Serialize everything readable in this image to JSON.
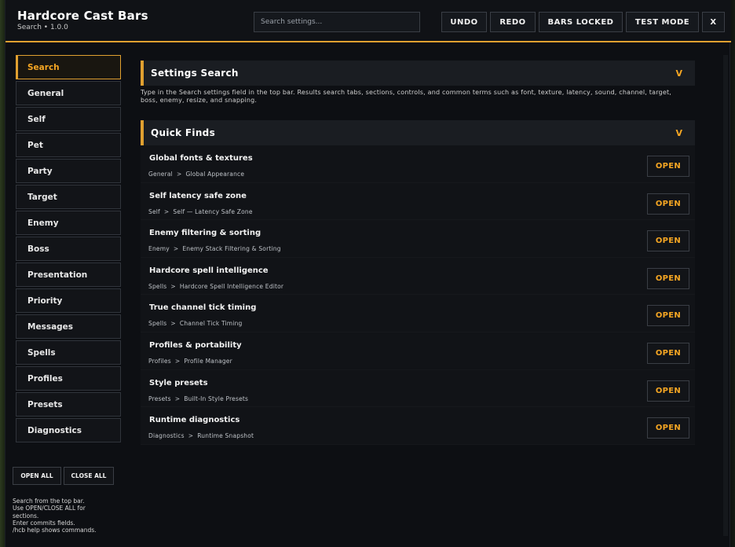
{
  "header": {
    "title": "Hardcore Cast Bars",
    "subtitle": "Search  •  1.0.0",
    "search_placeholder": "Search settings...",
    "buttons": {
      "undo": "UNDO",
      "redo": "REDO",
      "bars_locked": "BARS LOCKED",
      "test_mode": "TEST MODE",
      "close": "X"
    }
  },
  "sidebar": {
    "items": [
      {
        "label": "Search",
        "active": true
      },
      {
        "label": "General"
      },
      {
        "label": "Self"
      },
      {
        "label": "Pet"
      },
      {
        "label": "Party"
      },
      {
        "label": "Target"
      },
      {
        "label": "Enemy"
      },
      {
        "label": "Boss"
      },
      {
        "label": "Presentation"
      },
      {
        "label": "Priority"
      },
      {
        "label": "Messages"
      },
      {
        "label": "Spells"
      },
      {
        "label": "Profiles"
      },
      {
        "label": "Presets"
      },
      {
        "label": "Diagnostics"
      }
    ],
    "open_all": "OPEN ALL",
    "close_all": "CLOSE ALL",
    "help_lines": [
      "Search from the top bar.",
      "Use OPEN/CLOSE ALL for",
      "sections.",
      "Enter commits fields.",
      "/hcb help shows commands."
    ]
  },
  "main": {
    "settings_search": {
      "title": "Settings Search",
      "chevron": "V",
      "description": "Type in the Search settings field in the top bar. Results search tabs, sections, controls, and common terms such as font, texture, latency, sound, channel, target, boss, enemy, resize, and snapping."
    },
    "quick_finds": {
      "title": "Quick Finds",
      "chevron": "V",
      "open_label": "OPEN",
      "path_separator": ">",
      "rows": [
        {
          "title": "Global fonts & textures",
          "tab": "General",
          "section": "Global Appearance"
        },
        {
          "title": "Self latency safe zone",
          "tab": "Self",
          "section": "Self — Latency Safe Zone"
        },
        {
          "title": "Enemy filtering & sorting",
          "tab": "Enemy",
          "section": "Enemy Stack Filtering & Sorting"
        },
        {
          "title": "Hardcore spell intelligence",
          "tab": "Spells",
          "section": "Hardcore Spell Intelligence Editor"
        },
        {
          "title": "True channel tick timing",
          "tab": "Spells",
          "section": "Channel Tick Timing"
        },
        {
          "title": "Profiles & portability",
          "tab": "Profiles",
          "section": "Profile Manager"
        },
        {
          "title": "Style presets",
          "tab": "Presets",
          "section": "Built-In Style Presets"
        },
        {
          "title": "Runtime diagnostics",
          "tab": "Diagnostics",
          "section": "Runtime Snapshot"
        }
      ]
    }
  },
  "colors": {
    "accent": "#e0a030",
    "accent_text": "#f5a623",
    "background": "#0d0f13",
    "panel": "#1a1d22"
  }
}
